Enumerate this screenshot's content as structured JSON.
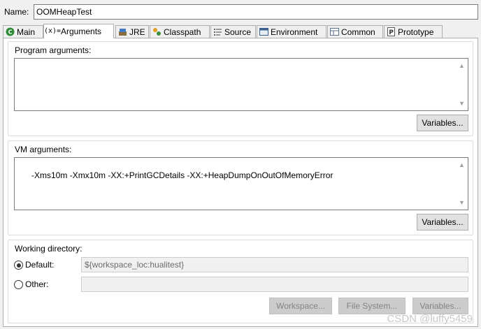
{
  "name": {
    "label": "Name:",
    "value": "OOMHeapTest"
  },
  "tabs": [
    {
      "label": "Main",
      "icon": "main-tab-icon"
    },
    {
      "label": "Arguments",
      "icon": "arguments-icon",
      "active": true
    },
    {
      "label": "JRE",
      "icon": "jre-icon"
    },
    {
      "label": "Classpath",
      "icon": "classpath-icon"
    },
    {
      "label": "Source",
      "icon": "source-icon"
    },
    {
      "label": "Environment",
      "icon": "environment-icon"
    },
    {
      "label": "Common",
      "icon": "common-icon"
    },
    {
      "label": "Prototype",
      "icon": "prototype-icon"
    }
  ],
  "program_arguments": {
    "title": "Program arguments:",
    "value": "",
    "variables_button": "Variables..."
  },
  "vm_arguments": {
    "title": "VM arguments:",
    "value": "-Xms10m -Xmx10m -XX:+PrintGCDetails -XX:+HeapDumpOnOutOfMemoryError",
    "variables_button": "Variables..."
  },
  "working_directory": {
    "title": "Working directory:",
    "default_label": "Default:",
    "default_selected": true,
    "default_value": "${workspace_loc:hualitest}",
    "other_label": "Other:",
    "other_value": "",
    "workspace_button": "Workspace...",
    "filesystem_button": "File System...",
    "variables_button": "Variables..."
  },
  "watermark": "CSDN @luffy5459",
  "colors": {
    "background": "#f0f0f0",
    "border": "#adadad",
    "disabled_text": "#838383"
  }
}
